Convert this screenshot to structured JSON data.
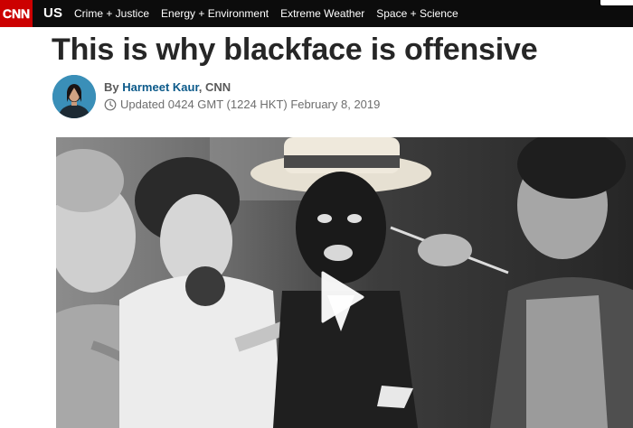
{
  "brand": {
    "logo_text": "CNN",
    "logo_color": "#cc0000"
  },
  "nav": {
    "edition": "US",
    "links": [
      "Crime + Justice",
      "Energy + Environment",
      "Extreme Weather",
      "Space + Science"
    ]
  },
  "article": {
    "headline": "This is why blackface is offensive",
    "byline": {
      "prefix": "By",
      "author": "Harmeet Kaur",
      "org": ", CNN"
    },
    "updated": "Updated 0424 GMT (1224 HKT) February 8, 2019"
  },
  "media": {
    "type": "video",
    "play_icon": "play-icon",
    "photo": "black-and-white-photo"
  },
  "colors": {
    "nav_bg": "#0c0c0c",
    "headline": "#262626",
    "author_link": "#0c5a8a"
  }
}
